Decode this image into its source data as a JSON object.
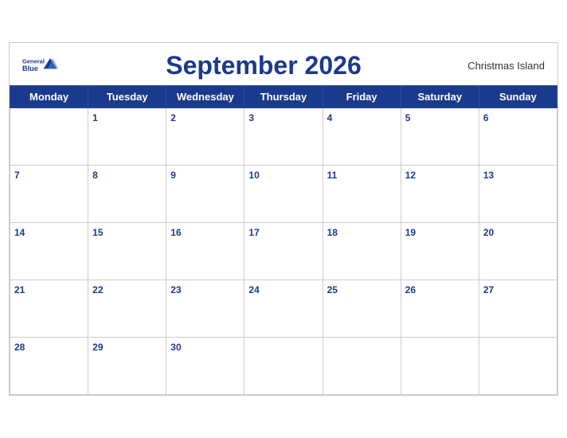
{
  "header": {
    "logo_line1": "General",
    "logo_line2": "Blue",
    "month_title": "September 2026",
    "region": "Christmas Island"
  },
  "weekdays": [
    "Monday",
    "Tuesday",
    "Wednesday",
    "Thursday",
    "Friday",
    "Saturday",
    "Sunday"
  ],
  "weeks": [
    [
      null,
      1,
      2,
      3,
      4,
      5,
      6
    ],
    [
      7,
      8,
      9,
      10,
      11,
      12,
      13
    ],
    [
      14,
      15,
      16,
      17,
      18,
      19,
      20
    ],
    [
      21,
      22,
      23,
      24,
      25,
      26,
      27
    ],
    [
      28,
      29,
      30,
      null,
      null,
      null,
      null
    ]
  ],
  "colors": {
    "header_bg": "#1a3a8c",
    "header_text": "#ffffff",
    "day_number": "#1a3a8c",
    "border": "#cccccc"
  }
}
